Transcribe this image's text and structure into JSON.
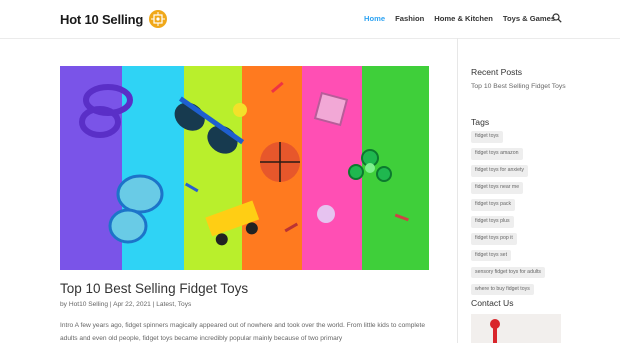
{
  "site": {
    "logo_text": "Hot 10 Selling"
  },
  "nav": {
    "items": [
      {
        "label": "Home",
        "active": true
      },
      {
        "label": "Fashion",
        "active": false
      },
      {
        "label": "Home & Kitchen",
        "active": false
      },
      {
        "label": "Toys & Games",
        "active": false
      }
    ],
    "search_icon": "search-icon"
  },
  "post": {
    "title": "Top 10 Best Selling Fidget Toys",
    "meta": {
      "by": "by",
      "author": "Hot10 Selling",
      "sep": " | ",
      "date": "Apr 22, 2021",
      "category1": "Latest",
      "comma": ", ",
      "category2": "Toys"
    },
    "excerpt": "Intro A few years ago, fidget spinners magically appeared out of nowhere and took over the world. From little kids to complete adults and even old people, fidget toys became incredibly popular mainly because of two primary"
  },
  "sidebar": {
    "recent_posts_title": "Recent Posts",
    "recent_posts": [
      "Top 10 Best Selling Fidget Toys"
    ],
    "tags_title": "Tags",
    "tags": [
      "fidget toys",
      "fidget toys amazon",
      "fidget toys for anxiety",
      "fidget toys near me",
      "fidget toys pack",
      "fidget toys plus",
      "fidget toys pop it",
      "fidget toys set",
      "sensory fidget toys for adults",
      "where to buy fidget toys"
    ],
    "contact_title": "Contact Us"
  },
  "colors": {
    "accent": "#2ea3f2",
    "logo_badge": "#f0a81a",
    "stripes": [
      "#7a54e8",
      "#2fd3f5",
      "#b9ef2c",
      "#ff7a1f",
      "#ff4fb4",
      "#3fcf3a"
    ]
  }
}
